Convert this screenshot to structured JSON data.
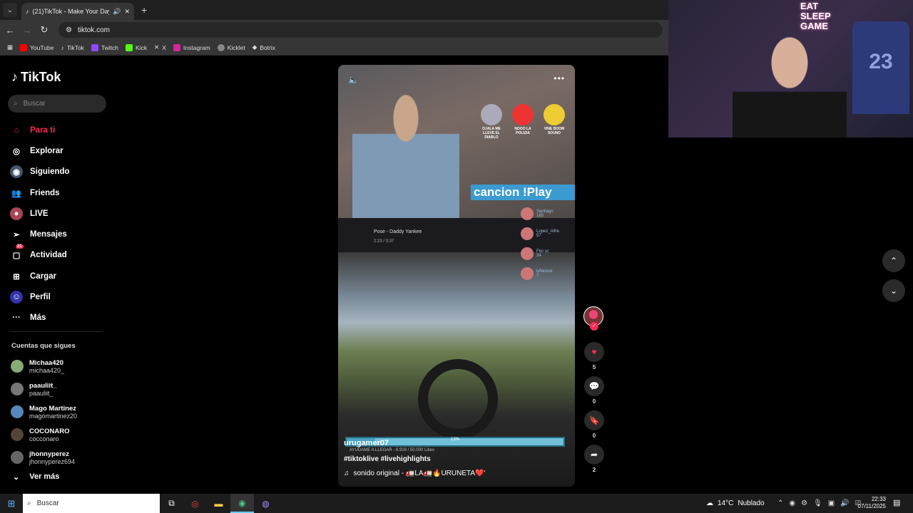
{
  "browser": {
    "tab_title": "(21)TikTok - Make Your Day",
    "url": "tiktok.com",
    "bookmarks": [
      "YouTube",
      "TikTok",
      "Twitch",
      "Kick",
      "X",
      "Instagram",
      "Kicklet",
      "Botrix"
    ]
  },
  "tiktok": {
    "logo": "TikTok",
    "search_placeholder": "Buscar",
    "nav": [
      {
        "label": "Para ti",
        "icon": "home-icon"
      },
      {
        "label": "Explorar",
        "icon": "compass-icon"
      },
      {
        "label": "Siguiendo",
        "icon": "following-icon"
      },
      {
        "label": "Friends",
        "icon": "friends-icon"
      },
      {
        "label": "LIVE",
        "icon": "live-icon"
      },
      {
        "label": "Mensajes",
        "icon": "send-icon"
      },
      {
        "label": "Actividad",
        "icon": "activity-icon",
        "badge": "21"
      },
      {
        "label": "Cargar",
        "icon": "upload-icon"
      },
      {
        "label": "Perfil",
        "icon": "profile-icon"
      },
      {
        "label": "Más",
        "icon": "more-icon"
      }
    ],
    "following_title": "Cuentas que sigues",
    "following": [
      {
        "name": "Michaa420",
        "handle": "michaa420_"
      },
      {
        "name": "paauliit_",
        "handle": "paauliit_"
      },
      {
        "name": "Mago Martinez",
        "handle": "magomartinez20"
      },
      {
        "name": "COCONARO",
        "handle": "cocconaro"
      },
      {
        "name": "jhonnyperez",
        "handle": "jhonnyperez694"
      }
    ],
    "see_more": "Ver más"
  },
  "video": {
    "author": "urugamer07",
    "tags": "#tiktoklive #livehighlights",
    "music": "sonido original - 🚛LA🚛🔥URUNETA❤️'",
    "overlay_banner": "cancion   !Play",
    "song_title": "Pose - Daddy Yankee",
    "song_time": "2:23 / 3:37",
    "progress_label": "13%",
    "progress": 0.13,
    "likes_goal": "AYÚDAME A LLEGAR - 6.928 / 50.000 Likes",
    "overlay_buttons": [
      "OJALA ME LLEVE EL DIABLO",
      "NOOO LA POLIZIA",
      "VINE BOOM SOUND"
    ],
    "top_fans": [
      {
        "name": "Santiago",
        "score": "165"
      },
      {
        "name": "Lopez_Alfre",
        "score": "57"
      },
      {
        "name": "Flor ur",
        "score": "34"
      },
      {
        "name": "ivNicoux",
        "score": "7"
      },
      {
        "name": "",
        "score": ""
      }
    ]
  },
  "actions": {
    "likes": "5",
    "comments": "0",
    "saves": "0",
    "shares": "2"
  },
  "webcam": {
    "neon_text": "EAT\nSLEEP\nGAME",
    "jersey": "23"
  },
  "taskbar": {
    "search": "Buscar",
    "temperature": "14°C",
    "weather": "Nublado",
    "time": "22:33",
    "date": "07/11/2025"
  },
  "colors": {
    "tiktok_red": "#fe2c55",
    "progress_blue": "#6fc0d8"
  }
}
